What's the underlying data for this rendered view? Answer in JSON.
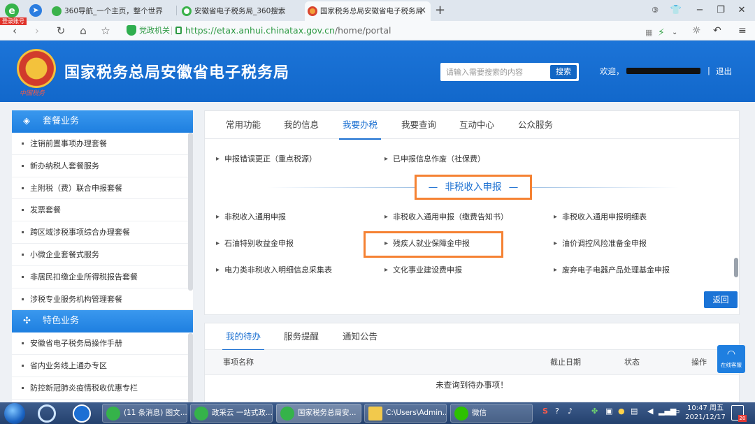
{
  "browser": {
    "login_badge": "登录账号",
    "tabs": [
      {
        "title": "360导航_一个主页，整个世界",
        "active": false
      },
      {
        "title": "安徽省电子税务局_360搜索",
        "active": false
      },
      {
        "title": "国家税务总局安徽省电子税务局",
        "active": true
      }
    ],
    "new_tab": "+",
    "window_controls": {
      "minimize": "−",
      "restore": "❐",
      "close": "✕"
    },
    "gov_label": "党政机关",
    "url_scheme": "https://",
    "url_host": "etax.anhui.chinatax.gov.cn",
    "url_path": "/home/portal"
  },
  "site": {
    "title": "国家税务总局安徽省电子税务局",
    "emblem_caption": "中国税务",
    "search_placeholder": "请输入需要搜索的内容",
    "search_button": "搜索",
    "welcome": "欢迎，",
    "separator": "|",
    "logout": "退出"
  },
  "sidebar": {
    "sections": [
      {
        "title": "套餐业务",
        "items": [
          "注销前置事项办理套餐",
          "新办纳税人套餐服务",
          "主附税（费）联合申报套餐",
          "发票套餐",
          "跨区域涉税事项综合办理套餐",
          "小微企业套餐式服务",
          "非居民扣缴企业所得税报告套餐",
          "涉税专业服务机构管理套餐"
        ]
      },
      {
        "title": "特色业务",
        "items": [
          "安徽省电子税务局操作手册",
          "省内业务线上通办专区",
          "防控新冠肺炎疫情税收优惠专栏"
        ]
      }
    ]
  },
  "main": {
    "tabs": [
      {
        "label": "常用功能",
        "active": false
      },
      {
        "label": "我的信息",
        "active": false
      },
      {
        "label": "我要办税",
        "active": true
      },
      {
        "label": "我要查询",
        "active": false
      },
      {
        "label": "互动中心",
        "active": false
      },
      {
        "label": "公众服务",
        "active": false
      }
    ],
    "top_links": [
      "申报错误更正（重点税源）",
      "已申报信息作废（社保费）"
    ],
    "section_title": "非税收入申报",
    "links": [
      [
        "非税收入通用申报",
        "非税收入通用申报（缴费告知书）",
        "非税收入通用申报明细表"
      ],
      [
        "石油特别收益金申报",
        "残疾人就业保障金申报",
        "油价调控风险准备金申报"
      ],
      [
        "电力类非税收入明细信息采集表",
        "文化事业建设费申报",
        "废弃电子电器产品处理基金申报"
      ]
    ],
    "back_button": "返回"
  },
  "todo": {
    "tabs": [
      {
        "label": "我的待办",
        "active": true
      },
      {
        "label": "服务提醒",
        "active": false
      },
      {
        "label": "通知公告",
        "active": false
      }
    ],
    "columns": {
      "name": "事项名称",
      "deadline": "截止日期",
      "status": "状态",
      "action": "操作"
    },
    "empty_message": "未查询到待办事项！"
  },
  "float_service": {
    "label": "在线客服"
  },
  "taskbar": {
    "tasks": [
      {
        "label": "(11 条消息) 图文...",
        "active": false
      },
      {
        "label": "政采云 一站式政...",
        "active": false
      },
      {
        "label": "国家税务总局安...",
        "active": true
      },
      {
        "label": "C:\\Users\\Admin...",
        "active": false
      },
      {
        "label": "微信",
        "active": false
      }
    ],
    "time": "10:47 周五",
    "date": "2021/12/17",
    "notification_count": "20"
  },
  "colors": {
    "accent": "#1a6fd1",
    "highlight": "#f58233",
    "header": "#1268cb"
  }
}
